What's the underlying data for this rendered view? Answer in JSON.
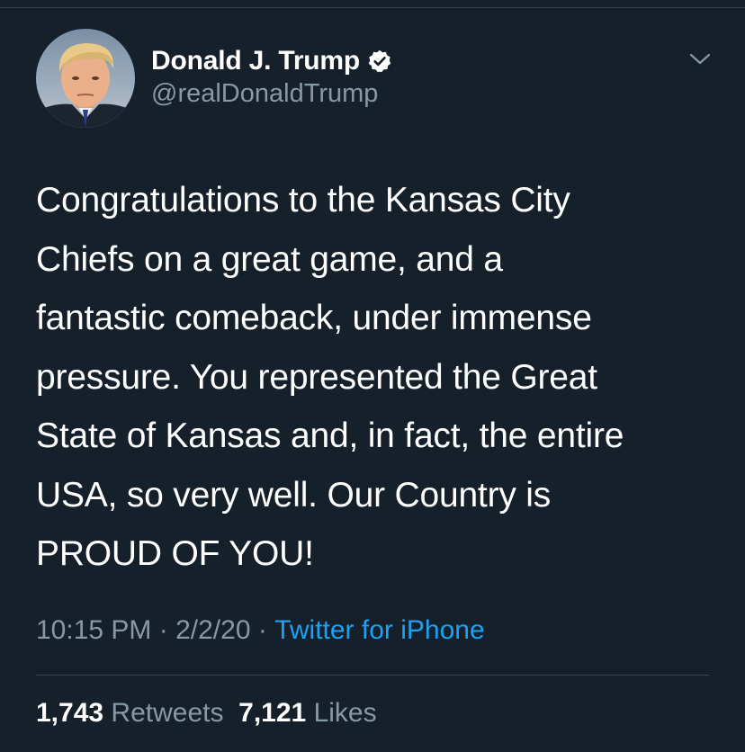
{
  "theme": {
    "background": "#15202b",
    "secondary_text": "#8899a6",
    "link": "#1da1f2",
    "divider": "#38444d"
  },
  "author": {
    "display_name": "Donald J. Trump",
    "handle": "@realDonaldTrump",
    "verified": true,
    "verified_icon": "verified-badge-icon",
    "avatar": "profile-photo"
  },
  "menu_icon": "chevron-down-icon",
  "tweet": {
    "text": "Congratulations to the Kansas City\nChiefs on a great game, and a\nfantastic comeback, under immense\npressure. You represented the Great\nState of Kansas and, in fact, the entire\nUSA, so very well. Our Country is\nPROUD OF YOU!"
  },
  "meta": {
    "time": "10:15 PM",
    "separator": " · ",
    "date": "2/2/20",
    "source": "Twitter for iPhone"
  },
  "stats": {
    "retweets_count": "1,743",
    "retweets_label": "Retweets",
    "likes_count": "7,121",
    "likes_label": "Likes"
  }
}
